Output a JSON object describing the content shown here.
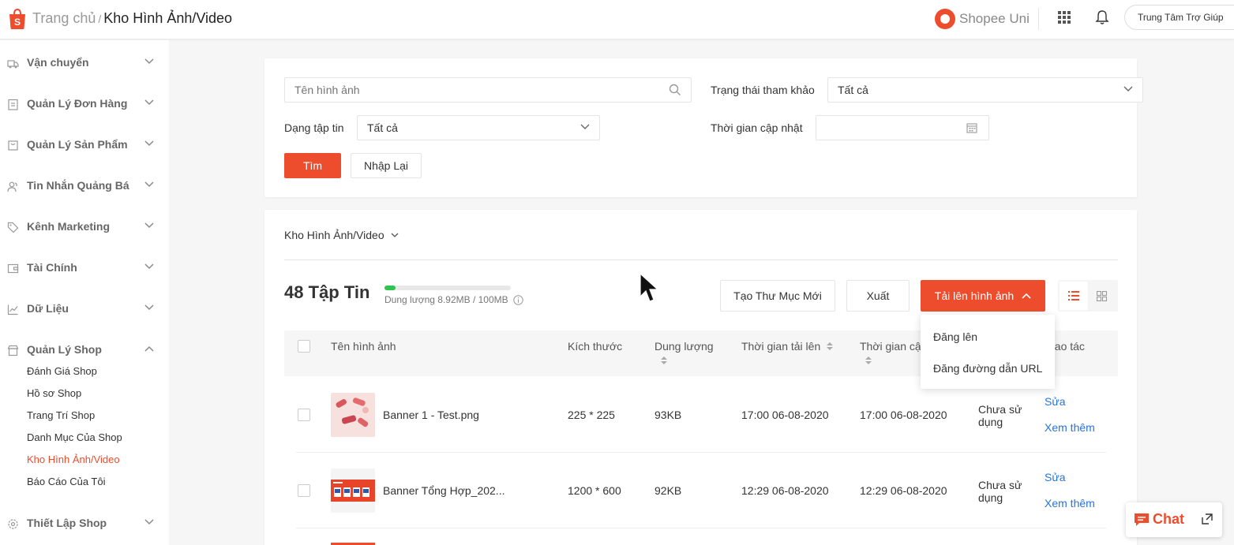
{
  "header": {
    "breadcrumb_home": "Trang chủ",
    "breadcrumb_sep": "/",
    "breadcrumb_current": "Kho Hình Ảnh/Video",
    "uni_label": "Shopee Uni",
    "help_label": "Trung Tâm Trợ Giúp"
  },
  "sidebar": {
    "sections": [
      {
        "label": "Vận chuyển",
        "icon": "truck-icon"
      },
      {
        "label": "Quản Lý Đơn Hàng",
        "icon": "clipboard-icon"
      },
      {
        "label": "Quản Lý Sản Phẩm",
        "icon": "bag-icon"
      },
      {
        "label": "Tin Nhắn Quảng Bá",
        "icon": "users-icon"
      },
      {
        "label": "Kênh Marketing",
        "icon": "tag-icon"
      },
      {
        "label": "Tài Chính",
        "icon": "wallet-icon"
      },
      {
        "label": "Dữ Liệu",
        "icon": "chart-icon"
      },
      {
        "label": "Quản Lý Shop",
        "icon": "shop-icon"
      },
      {
        "label": "Thiết Lập Shop",
        "icon": "gear-icon"
      }
    ],
    "shop_items": [
      "Đánh Giá Shop",
      "Hồ sơ Shop",
      "Trang Trí Shop",
      "Danh Mục Của Shop",
      "Kho Hình Ảnh/Video",
      "Báo Cáo Của Tôi"
    ],
    "active_item": "Kho Hình Ảnh/Video"
  },
  "filters": {
    "name_placeholder": "Tên hình ảnh",
    "status_label": "Trạng thái tham khảo",
    "status_value": "Tất cả",
    "type_label": "Dạng tập tin",
    "type_value": "Tất cả",
    "time_label": "Thời gian cập nhật",
    "search_button": "Tìm",
    "reset_button": "Nhập Lại"
  },
  "library": {
    "folder_selector": "Kho Hình Ảnh/Video",
    "file_count_label": "48 Tập Tin",
    "storage_label": "Dung lượng 8.92MB / 100MB",
    "storage_used_fraction": 0.0892,
    "new_folder_button": "Tạo Thư Mục Mới",
    "export_button": "Xuất",
    "upload_button": "Tải lên hình ảnh",
    "upload_menu": [
      "Đăng lên",
      "Đăng đường dẫn URL"
    ],
    "colors": {
      "accent": "#ee4d2d",
      "link": "#2673dd",
      "progress": "#2fc44e"
    }
  },
  "table": {
    "columns": {
      "name": "Tên hình ảnh",
      "size": "Kích thước",
      "capacity": "Dung lượng",
      "uploaded": "Thời gian tải lên",
      "updated": "Thời gian cậ",
      "actions": "hao tác"
    },
    "rows": [
      {
        "name": "Banner 1 - Test.png",
        "dimensions": "225 * 225",
        "filesize": "93KB",
        "uploaded": "17:00 06-08-2020",
        "updated": "17:00 06-08-2020",
        "status": "Chưa sử dụng",
        "edit": "Sửa",
        "more": "Xem thêm"
      },
      {
        "name": "Banner Tổng Hợp_202...",
        "dimensions": "1200 * 600",
        "filesize": "92KB",
        "uploaded": "12:29 06-08-2020",
        "updated": "12:29 06-08-2020",
        "status": "Chưa sử dụng",
        "edit": "Sửa",
        "more": "Xem thêm"
      }
    ]
  },
  "chat": {
    "label": "Chat"
  }
}
